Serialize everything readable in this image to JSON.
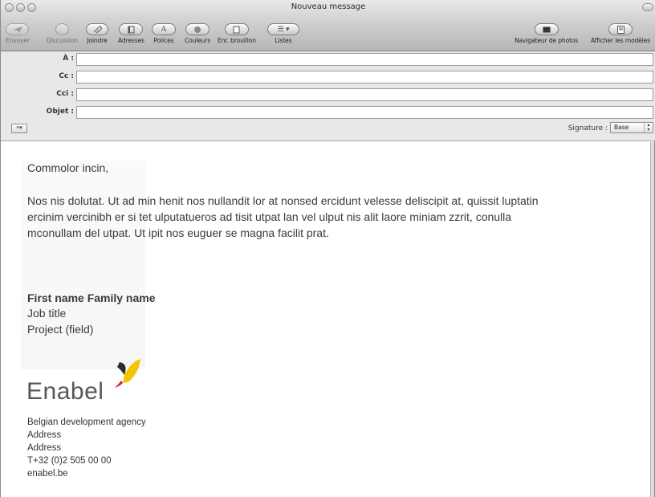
{
  "window": {
    "title": "Nouveau message"
  },
  "toolbar": {
    "envoyer": "Envoyer",
    "discussion": "Discussion",
    "joindre": "Joindre",
    "adresses": "Adresses",
    "polices": "Polices",
    "couleurs": "Couleurs",
    "brouillon": "Enr. brouillon",
    "listes": "Listes",
    "navigateur": "Navigateur de photos",
    "modeles": "Afficher les modèles"
  },
  "header": {
    "to_label": "À :",
    "cc_label": "Cc :",
    "bcc_label": "Cci :",
    "subject_label": "Objet :",
    "to_value": "",
    "cc_value": "",
    "bcc_value": "",
    "subject_value": "",
    "signature_label": "Signature :",
    "signature_value": "Base"
  },
  "message": {
    "greeting": "Commolor incin,",
    "paragraph": "Nos nis dolutat. Ut ad min henit nos nullandit lor at nonsed ercidunt velesse deliscipit at, quissit luptatin ercinim vercinibh er si tet ulputatueros ad tisit utpat lan vel ulput nis alit laore miniam zzrit, conulla mconullam del utpat. Ut ipit nos euguer se magna facilit prat.",
    "sig_name": "First name Family name",
    "sig_job": "Job title",
    "sig_project": "Project (field)",
    "logo_text": "Enabel",
    "agency": "Belgian development agency",
    "address1": "Address",
    "address2": "Address",
    "phone": "T+32 (0)2 505 00 00",
    "website": "enabel.be"
  },
  "colors": {
    "logo_yellow": "#f5c400",
    "logo_red": "#d81e2a",
    "logo_dark": "#2b2b2b",
    "logo_text": "#575757"
  }
}
